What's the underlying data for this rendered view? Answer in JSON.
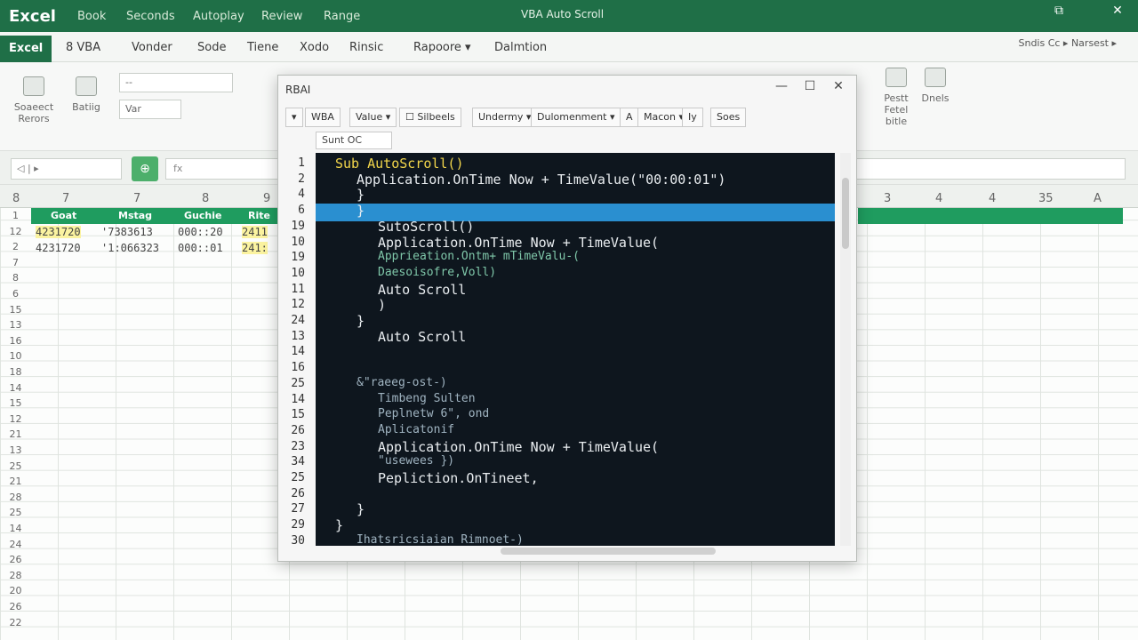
{
  "app": {
    "logo": "Excel",
    "title": "VBA Auto Scroll",
    "title_menus": [
      "Book",
      "Seconds",
      "Autoplay",
      "Review",
      "Range"
    ],
    "window_controls": [
      "⧉",
      "✕"
    ]
  },
  "ribbon_tabs": {
    "items": [
      "Excel",
      "8 VBA",
      "Vonder",
      "Sode",
      "Tiene",
      "Xodo",
      "Rinsic",
      "Rapoore ▾",
      "Dalmtion"
    ],
    "right_text": "Sndis Cc ▸ Narsest ▸"
  },
  "ribbon": {
    "buttons": [
      "Soaeect Rerors",
      "Batiig",
      "Pestt Fetel bitle",
      "Dnels"
    ],
    "dropdown_value": "--",
    "var_label": "Var"
  },
  "formula_bar": {
    "namebox": "◁ | ▸",
    "fx_button": "⊕",
    "content": "fx"
  },
  "sheet": {
    "col_headers": [
      "8",
      "7",
      "7",
      "8",
      "9",
      "3",
      "4",
      "4",
      "35",
      "A"
    ],
    "header_row": [
      "Goat",
      "Mstag",
      "Guchie",
      "Rite"
    ],
    "rows": [
      {
        "num": "12",
        "cells": [
          "4231720",
          "'7383613",
          "000::20",
          "2411"
        ]
      },
      {
        "num": "2",
        "cells": [
          "4231720",
          "'1:066323",
          "000::01",
          "241:"
        ]
      }
    ],
    "row_numbers": [
      "1",
      "12",
      "2",
      "7",
      "8",
      "6",
      "15",
      "13",
      "16",
      "10",
      "18",
      "14",
      "15",
      "12",
      "21",
      "13",
      "25",
      "21",
      "28",
      "25",
      "14",
      "24",
      "26",
      "28",
      "20",
      "26",
      "22"
    ]
  },
  "vba": {
    "title": "RBAI",
    "controls": [
      "—",
      "☐",
      "✕"
    ],
    "toolbar": [
      "▾",
      "WBA",
      "Value ▾",
      "☐ Silbeels",
      "Undermy ▾",
      "Dulomenment ▾",
      "A",
      "Macon ▾",
      "Iy",
      "Soes"
    ],
    "select_value": "Sunt OC",
    "code_lines": [
      {
        "n": "1",
        "text": "Sub AutoScroll()",
        "indent": 0
      },
      {
        "n": "2",
        "text": "Application.OnTime Now + TimeValue(\"00:00:01\")",
        "indent": 1
      },
      {
        "n": "4",
        "text": "}",
        "indent": 1
      },
      {
        "n": "6",
        "text": "}",
        "indent": 1
      },
      {
        "n": "19",
        "text": "SutoScroll()",
        "indent": 2
      },
      {
        "n": "10",
        "text": "Application.OnTime Now + TimeValue(",
        "indent": 2
      },
      {
        "n": "19",
        "text": "Apprieation.Ontm+ mTimeValu-(",
        "indent": 2
      },
      {
        "n": "10",
        "text": "Daesoisofre,Voll)",
        "indent": 2
      },
      {
        "n": "11",
        "text": "Auto Scroll",
        "indent": 2
      },
      {
        "n": "12",
        "text": ")",
        "indent": 2
      },
      {
        "n": "24",
        "text": "}",
        "indent": 1
      },
      {
        "n": "13",
        "text": "Auto Scroll",
        "indent": 2
      },
      {
        "n": "14",
        "text": "",
        "indent": 0
      },
      {
        "n": "16",
        "text": "",
        "indent": 0
      },
      {
        "n": "25",
        "text": "&\"raeeg-ost-)",
        "indent": 1
      },
      {
        "n": "14",
        "text": "Timbeng Sulten",
        "indent": 2
      },
      {
        "n": "15",
        "text": "Peplnetw 6\", ond",
        "indent": 2
      },
      {
        "n": "26",
        "text": "Aplicatonif",
        "indent": 2
      },
      {
        "n": "23",
        "text": "Application.OnTime Now + TimeValue(",
        "indent": 2
      },
      {
        "n": "34",
        "text": "\"usewees })",
        "indent": 2
      },
      {
        "n": "25",
        "text": "Pepliction.OnTineet,",
        "indent": 2
      },
      {
        "n": "26",
        "text": "",
        "indent": 0
      },
      {
        "n": "27",
        "text": "}",
        "indent": 1
      },
      {
        "n": "29",
        "text": "}",
        "indent": 0
      },
      {
        "n": "30",
        "text": "Ihatsricsiaian Rimnoet-)",
        "indent": 1
      }
    ]
  }
}
